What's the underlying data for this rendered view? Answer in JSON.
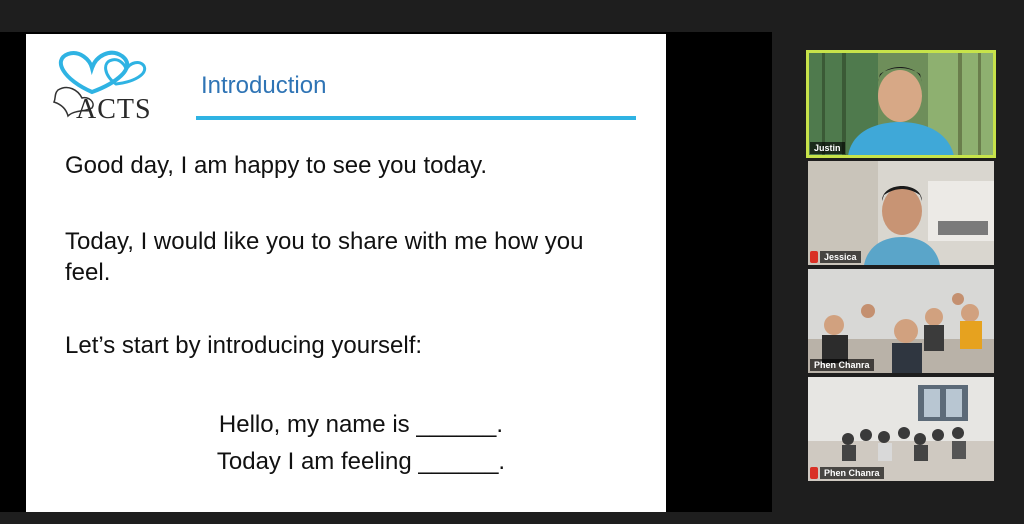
{
  "slide": {
    "logo_text": "ACTS",
    "title": "Introduction",
    "line1": "Good day, I am happy to see you today.",
    "line2": "Today, I would like you to share with me how you feel.",
    "line3": "Let’s start by introducing yourself:",
    "line4": "Hello, my name is ______.",
    "line5": "Today I am feeling ______."
  },
  "participants": [
    {
      "name": "Justin",
      "active": true
    },
    {
      "name": "Jessica",
      "muted": true
    },
    {
      "name": "Phen Chanra"
    },
    {
      "name": "Phen Chanra",
      "muted": true
    }
  ],
  "colors": {
    "accent_blue": "#2fb3e3",
    "title_blue": "#2f74b5",
    "active_speaker": "#c7e34a",
    "muted_red": "#d93025"
  }
}
